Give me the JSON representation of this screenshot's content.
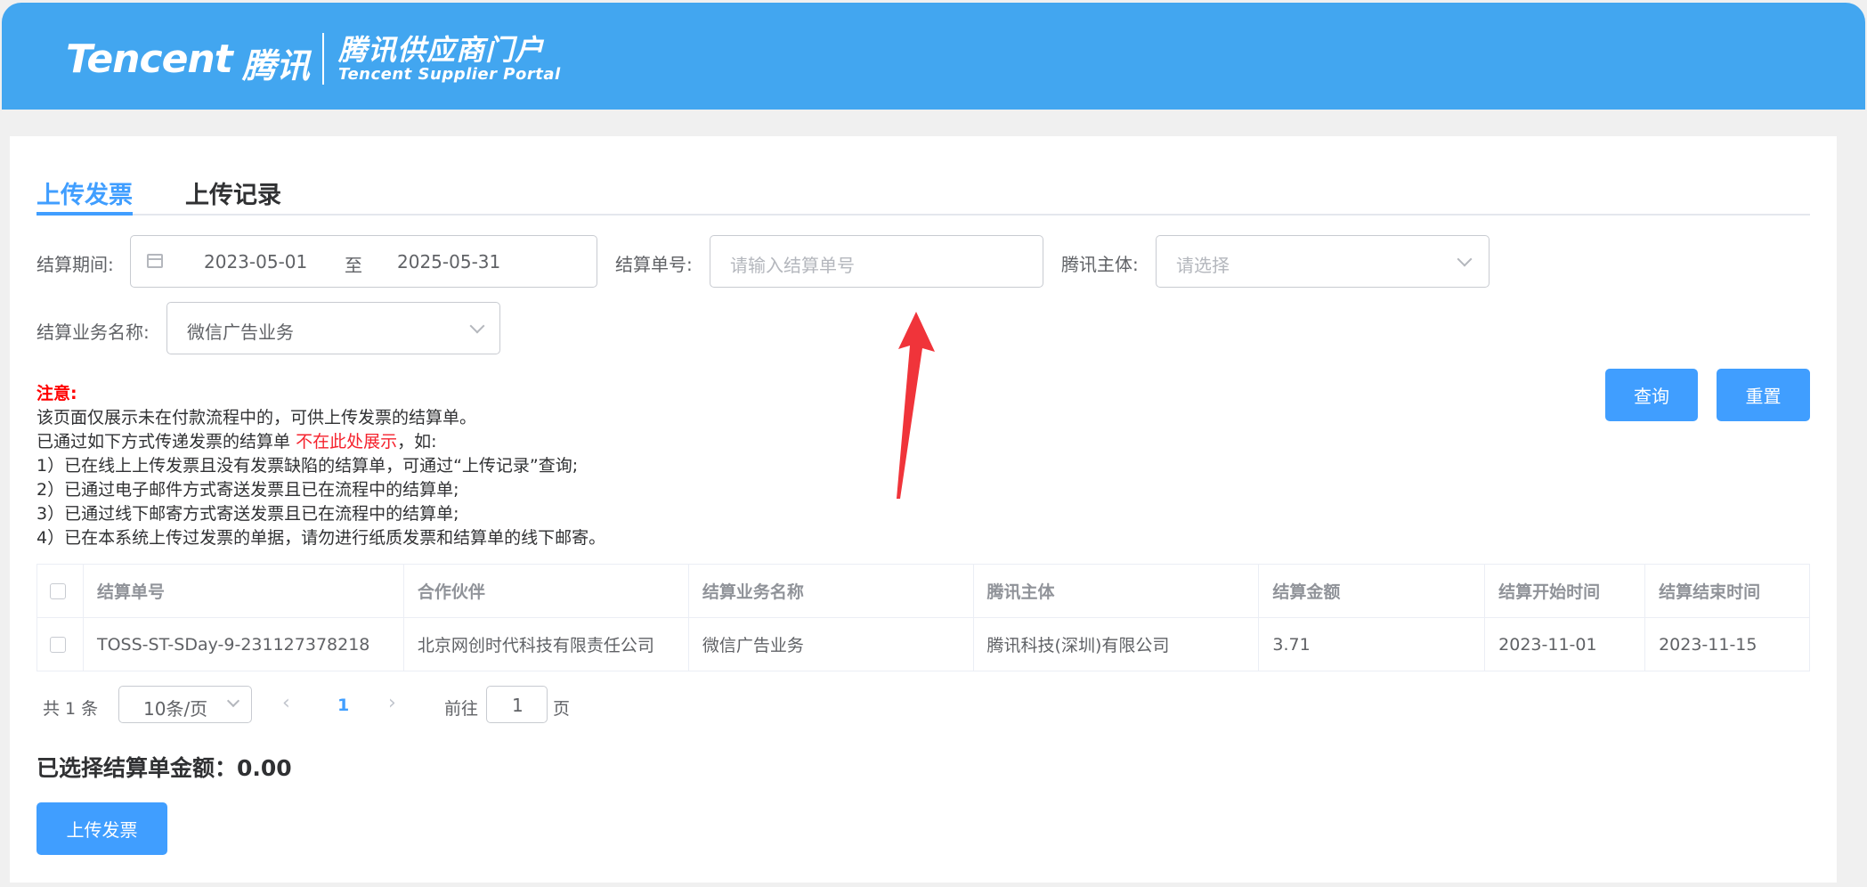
{
  "header": {
    "logo_word": "Tencent",
    "logo_cn": "腾讯",
    "portal_title": "腾讯供应商门户",
    "portal_subtitle": "Tencent Supplier Portal"
  },
  "tabs": [
    {
      "label": "上传发票",
      "active": true
    },
    {
      "label": "上传记录",
      "active": false
    }
  ],
  "filters": {
    "period_label": "结算期间:",
    "period_start": "2023-05-01",
    "period_sep": "至",
    "period_end": "2025-05-31",
    "bill_no_label": "结算单号:",
    "bill_no_placeholder": "请输入结算单号",
    "entity_label": "腾讯主体:",
    "entity_placeholder": "请选择",
    "biz_label": "结算业务名称:",
    "biz_value": "微信广告业务"
  },
  "buttons": {
    "query": "查询",
    "reset": "重置",
    "upload": "上传发票"
  },
  "notice": {
    "title": "注意:",
    "line1": "该页面仅展示未在付款流程中的，可供上传发票的结算单。",
    "line2_pre": "已通过如下方式传递发票的结算单",
    "line2_red": "不在此处展示",
    "line2_post": "，如:",
    "items": [
      "1）已在线上上传发票且没有发票缺陷的结算单，可通过“上传记录”查询;",
      "2）已通过电子邮件方式寄送发票且已在流程中的结算单;",
      "3）已通过线下邮寄方式寄送发票且已在流程中的结算单;",
      "4）已在本系统上传过发票的单据，请勿进行纸质发票和结算单的线下邮寄。"
    ]
  },
  "table": {
    "columns": [
      "结算单号",
      "合作伙伴",
      "结算业务名称",
      "腾讯主体",
      "结算金额",
      "结算开始时间",
      "结算结束时间"
    ],
    "rows": [
      [
        "TOSS-ST-SDay-9-231127378218",
        "北京网创时代科技有限责任公司",
        "微信广告业务",
        "腾讯科技(深圳)有限公司",
        "3.71",
        "2023-11-01",
        "2023-11-15"
      ]
    ]
  },
  "pagination": {
    "total": "共 1 条",
    "page_size": "10条/页",
    "current_page": "1",
    "goto_label": "前往",
    "goto_value": "1",
    "goto_suffix": "页"
  },
  "summary": {
    "selected_amount": "已选择结算单金额：0.00"
  },
  "colors": {
    "header_bg": "#42a6f0",
    "primary": "#409eff",
    "warning_red": "#f5222d",
    "annotation_arrow": "#f0343a"
  },
  "icons": [
    "calendar-icon",
    "chevron-down-icon",
    "chevron-left-icon",
    "chevron-right-icon",
    "red-arrow-annotation"
  ]
}
